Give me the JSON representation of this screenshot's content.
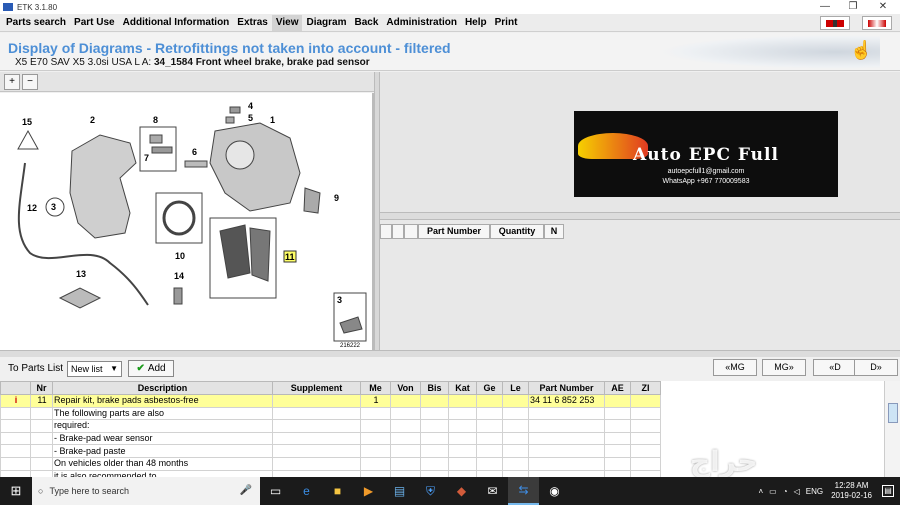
{
  "window": {
    "title": "ETK 3.1.80",
    "minimize": "—",
    "restore": "❐",
    "close": "✕"
  },
  "menu": [
    "Parts search",
    "Part Use",
    "Additional Information",
    "Extras",
    "View",
    "Diagram",
    "Back",
    "Administration",
    "Help",
    "Print"
  ],
  "menu_active_index": 4,
  "header": {
    "title": "Display of Diagrams - Retrofittings not taken into account - filtered",
    "subtitle_prefix": "X5 E70 SAV X5 3.0si USA  L A:",
    "subtitle_bold": "34_1584 Front wheel brake, brake pad sensor"
  },
  "zoom": {
    "in": "+",
    "out": "−"
  },
  "diagram": {
    "callouts": [
      "1",
      "2",
      "3",
      "4",
      "5",
      "6",
      "7",
      "8",
      "9",
      "10",
      "11",
      "12",
      "13",
      "14",
      "15"
    ],
    "highlighted": "11",
    "ref": "216222"
  },
  "logo": {
    "title": "Auto EPC Full",
    "email": "autoepcfull1@gmail.com",
    "phone": "WhatsApp +967 770009583"
  },
  "parts_table": {
    "headers": [
      "Part Number",
      "Quantity",
      "N"
    ]
  },
  "list_bar": {
    "label": "To Parts List",
    "select_value": "New list",
    "add_label": "Add"
  },
  "nav": {
    "prev_mg": "«MG",
    "next_mg": "MG»",
    "prev_d": "«D",
    "next_d": "D»"
  },
  "grid": {
    "headers": [
      "",
      "Nr",
      "Description",
      "Supplement",
      "Me",
      "Von",
      "Bis",
      "Kat",
      "Ge",
      "Le",
      "Part Number",
      "AE",
      "ZI"
    ],
    "rows": [
      {
        "icon": "i",
        "nr": "11",
        "desc": "Repair kit, brake pads asbestos-free",
        "me": "1",
        "part": "34 11 6 852 253"
      },
      {
        "icon": "",
        "nr": "",
        "desc": "The following parts are also",
        "me": "",
        "part": ""
      },
      {
        "icon": "",
        "nr": "",
        "desc": "required:",
        "me": "",
        "part": ""
      },
      {
        "icon": "",
        "nr": "",
        "desc": "- Brake-pad wear sensor",
        "me": "",
        "part": ""
      },
      {
        "icon": "",
        "nr": "",
        "desc": "- Brake-pad paste",
        "me": "",
        "part": ""
      },
      {
        "icon": "",
        "nr": "",
        "desc": "On vehicles older than 48 months",
        "me": "",
        "part": ""
      },
      {
        "icon": "",
        "nr": "",
        "desc": "it is also recommended to",
        "me": "",
        "part": ""
      }
    ]
  },
  "watermark": "حراج",
  "taskbar": {
    "search_placeholder": "Type here to search",
    "lang": "ENG",
    "time": "12:28 AM",
    "date": "2019-02-16"
  }
}
